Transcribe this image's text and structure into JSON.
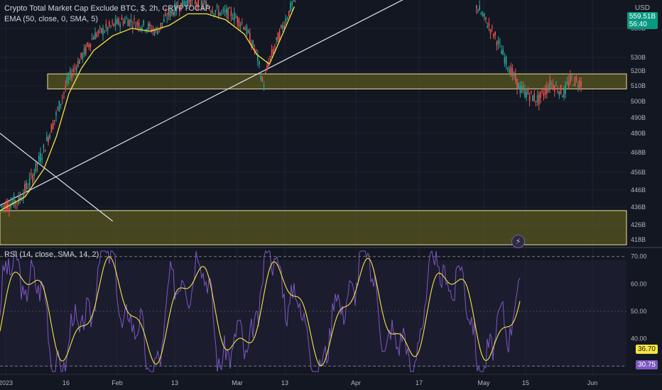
{
  "chart": {
    "title": "Crypto Total Market Cap Exclude BTC, $, 2h, CRYPTOCAP",
    "ema_label": "EMA (50, close, 0, SMA, 5)",
    "rsi_label": "RSI (14, close, SMA, 14, 2)",
    "currency": "USD",
    "last_price": "559.51B",
    "countdown": "56:40",
    "rsi_value": "36.70",
    "rsi_ma_value": "30.75"
  },
  "chart_data": [
    {
      "type": "line",
      "title": "Crypto Total Market Cap Exclude BTC, $, 2h, CRYPTOCAP",
      "ylabel": "USD",
      "y_tick_labels": [
        "550B",
        "530B",
        "520B",
        "510B",
        "500B",
        "490B",
        "480B",
        "468B",
        "456B",
        "446B",
        "436B",
        "426B",
        "418B"
      ],
      "x_tick_labels": [
        "2023",
        "16",
        "Feb",
        "13",
        "Mar",
        "13",
        "Apr",
        "17",
        "May",
        "15",
        "Jun"
      ],
      "series": [
        {
          "name": "Crypto Total Market Cap Exclude BTC",
          "points": [
            [
              0,
              436
            ],
            [
              0.03,
              440
            ],
            [
              0.05,
              452
            ],
            [
              0.07,
              470
            ],
            [
              0.09,
              492
            ],
            [
              0.11,
              515
            ],
            [
              0.13,
              530
            ],
            [
              0.15,
              545
            ],
            [
              0.18,
              552
            ],
            [
              0.2,
              556
            ],
            [
              0.23,
              552
            ],
            [
              0.25,
              548
            ],
            [
              0.27,
              560
            ],
            [
              0.3,
              570
            ],
            [
              0.33,
              566
            ],
            [
              0.35,
              561
            ],
            [
              0.37,
              560
            ],
            [
              0.39,
              552
            ],
            [
              0.41,
              532
            ],
            [
              0.42,
              510
            ],
            [
              0.43,
              528
            ],
            [
              0.45,
              550
            ],
            [
              0.47,
              570
            ],
            [
              0.76,
              566
            ],
            [
              0.79,
              545
            ],
            [
              0.81,
              525
            ],
            [
              0.83,
              508
            ],
            [
              0.85,
              503
            ],
            [
              0.86,
              501
            ],
            [
              0.88,
              512
            ],
            [
              0.9,
              505
            ],
            [
              0.91,
              514
            ],
            [
              0.93,
              512
            ]
          ]
        },
        {
          "name": "EMA (50, close, 0, SMA, 5)",
          "points": [
            [
              0,
              434
            ],
            [
              0.04,
              442
            ],
            [
              0.07,
              458
            ],
            [
              0.09,
              478
            ],
            [
              0.11,
              505
            ],
            [
              0.13,
              522
            ],
            [
              0.15,
              535
            ],
            [
              0.18,
              545
            ],
            [
              0.21,
              550
            ],
            [
              0.24,
              548
            ],
            [
              0.27,
              552
            ],
            [
              0.3,
              560
            ],
            [
              0.33,
              560
            ],
            [
              0.36,
              556
            ],
            [
              0.39,
              546
            ],
            [
              0.41,
              532
            ],
            [
              0.43,
              525
            ],
            [
              0.45,
              545
            ],
            [
              0.47,
              565
            ]
          ]
        }
      ],
      "zones": [
        {
          "range": [
            508,
            518
          ],
          "label": "510B"
        },
        {
          "range": [
            412,
            434
          ],
          "label": "426B"
        }
      ],
      "trendlines": [
        {
          "from": [
            0,
            437
          ],
          "to": [
            0.69,
            580
          ]
        },
        {
          "from": [
            0,
            480
          ],
          "to": [
            0.18,
            428
          ]
        }
      ]
    },
    {
      "type": "line",
      "title": "RSI (14, close, SMA, 14, 2)",
      "y_tick_labels": [
        "70.00",
        "60.00",
        "50.00",
        "40.00"
      ],
      "ylim": [
        28,
        72
      ],
      "bands": [
        30,
        70
      ],
      "series": [
        {
          "name": "RSI",
          "last_value": 30.75
        },
        {
          "name": "RSI MA",
          "last_value": 36.7
        }
      ]
    }
  ],
  "colors": {
    "background": "#131722",
    "grid": "#1f2331",
    "up": "#26a69a",
    "down": "#ef5350",
    "ema": "#f5e442",
    "rsi": "#7e57c2",
    "rsi_ma": "#f5e442",
    "zone_fill": "#5b5a1e",
    "zone_border": "#e8e39a",
    "price_tag": "#089981"
  },
  "icons": {
    "replay": "lightning-icon"
  }
}
